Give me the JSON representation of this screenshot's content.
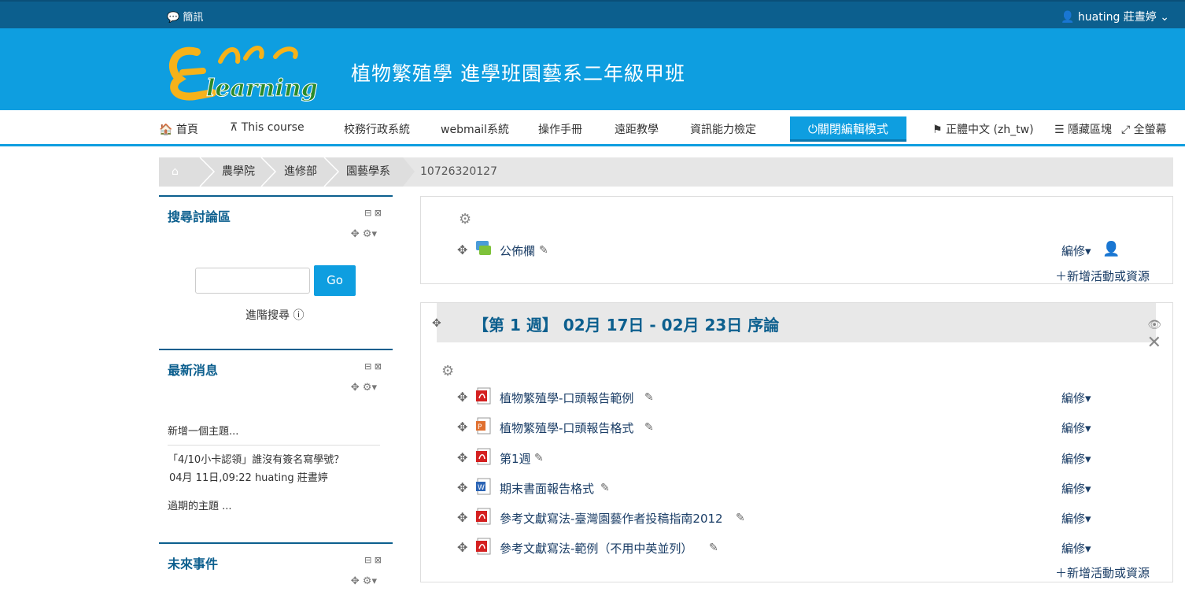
{
  "topbar": {
    "messages": "簡訊",
    "user": "huating 莊晝婷"
  },
  "banner": {
    "course_title": "植物繁殖學 進學班園藝系二年級甲班",
    "logo_text": "Elearning"
  },
  "nav": {
    "home": "首頁",
    "this_course": "This course",
    "school_admin": "校務行政系統",
    "webmail": "webmail系統",
    "manual": "操作手冊",
    "distance": "遠距教學",
    "it_cert": "資訊能力檢定",
    "edit_mode": "關閉編輯模式",
    "language": "正體中文 (zh_tw)",
    "hide_blocks": "隱藏區塊",
    "fullscreen": "全螢幕"
  },
  "breadcrumb": {
    "items": [
      "農學院",
      "進修部",
      "園藝學系"
    ],
    "current": "10726320127"
  },
  "blocks": {
    "search": {
      "title": "搜尋討論區",
      "go": "Go",
      "advanced": "進階搜尋"
    },
    "news": {
      "title": "最新消息",
      "add": "新增一個主題...",
      "item_title": "「4/10小卡認領」誰沒有簽名寫學號？",
      "item_meta": "04月 11日,09:22  huating 莊晝婷",
      "older": "過期的主題 ..."
    },
    "events": {
      "title": "未來事件"
    }
  },
  "section0": {
    "forum": "公佈欄",
    "edit": "編修",
    "add": "新增活動或資源"
  },
  "section1": {
    "title": "【第 1 週】 02月 17日 - 02月 23日 序論",
    "edit": "編修",
    "add": "新增活動或資源",
    "activities": [
      {
        "name": "植物繁殖學-口頭報告範例",
        "icon": "pdf-icon"
      },
      {
        "name": "植物繁殖學-口頭報告格式",
        "icon": "ppt-icon"
      },
      {
        "name": "第1週",
        "icon": "pdf-icon"
      },
      {
        "name": "期末書面報告格式",
        "icon": "word-icon"
      },
      {
        "name": "參考文獻寫法-臺灣園藝作者投稿指南2012",
        "icon": "pdf-icon"
      },
      {
        "name": "參考文獻寫法-範例（不用中英並列）",
        "icon": "pdf-icon"
      }
    ]
  },
  "colors": {
    "dark_blue": "#0c5f8e",
    "brand_blue": "#0e9ee0",
    "pdf_red": "#d42020"
  }
}
